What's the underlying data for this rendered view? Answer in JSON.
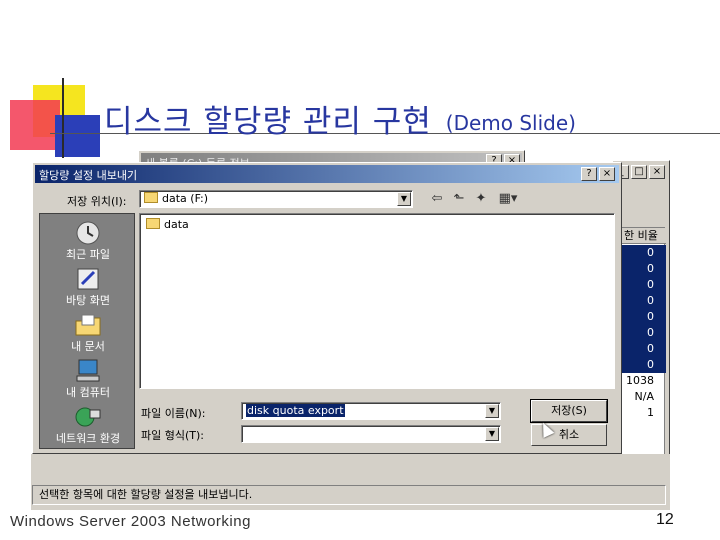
{
  "slide": {
    "title": "디스크 할당량 관리 구현",
    "title_sub": "(Demo Slide)",
    "footer_left": "Windows  Server 2003 Networking",
    "page_number": "12",
    "colors": {
      "title": "#2837a0",
      "yellow": "#f5e51f",
      "red": "#f23a52",
      "blue": "#2b3fb8"
    }
  },
  "bg_window": {
    "title": "새 볼륨 (C:) 등록 정보",
    "column_header": "한 비율",
    "values": [
      "0",
      "0",
      "0",
      "0",
      "0",
      "0",
      "0",
      "0",
      "1038",
      "N/A",
      "1"
    ],
    "selected_count": 8
  },
  "dialog": {
    "title": "할당량 설정 내보내기",
    "location_label": "저장 위치(I):",
    "location_value": "data (F:)",
    "files": [
      {
        "name": "data",
        "icon": "folder-icon"
      }
    ],
    "places": [
      {
        "label": "최근 파일",
        "icon": "recent-icon"
      },
      {
        "label": "바탕 화면",
        "icon": "desktop-icon"
      },
      {
        "label": "내 문서",
        "icon": "my-documents-icon"
      },
      {
        "label": "내 컴퓨터",
        "icon": "my-computer-icon"
      },
      {
        "label": "네트워크 환경",
        "icon": "network-icon"
      }
    ],
    "filename_label": "파일 이름(N):",
    "filename_value": "disk quota export",
    "filetype_label": "파일 형식(T):",
    "filetype_value": "",
    "save_label": "저장(S)",
    "cancel_label": "취소"
  },
  "status_text": "선택한 항목에 대한 할당량 설정을 내보냅니다."
}
